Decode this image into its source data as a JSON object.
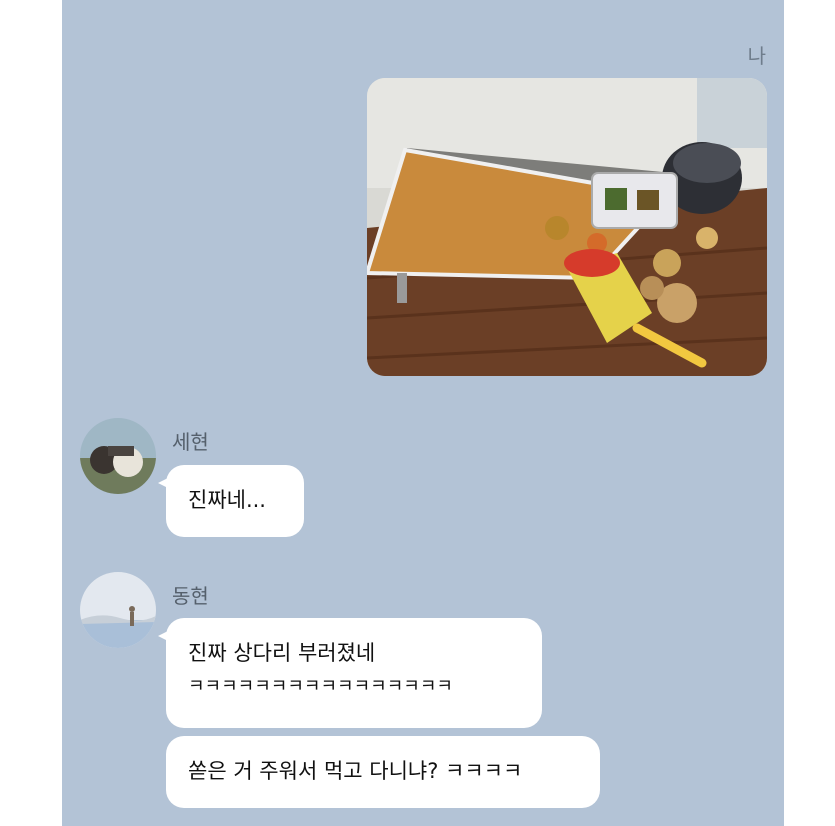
{
  "chat": {
    "me_label": "나",
    "messages": [
      {
        "sender": "세현",
        "lines": [
          "진짜네..."
        ]
      },
      {
        "sender": "동현",
        "lines": [
          "진짜 상다리 부러졌네",
          "ㅋㅋㅋㅋㅋㅋㅋㅋㅋㅋㅋㅋㅋㅋㅋㅋ"
        ]
      },
      {
        "sender": "동현",
        "lines": [
          "쏟은 거 주워서 먹고 다니냐? ㅋㅋㅋㅋ"
        ]
      }
    ],
    "icons": {
      "photo": "photo-icon",
      "avatar1": "avatar-icon",
      "avatar2": "avatar-icon"
    },
    "colors": {
      "chat_bg": "#b3c3d6",
      "bubble": "#ffffff"
    }
  }
}
